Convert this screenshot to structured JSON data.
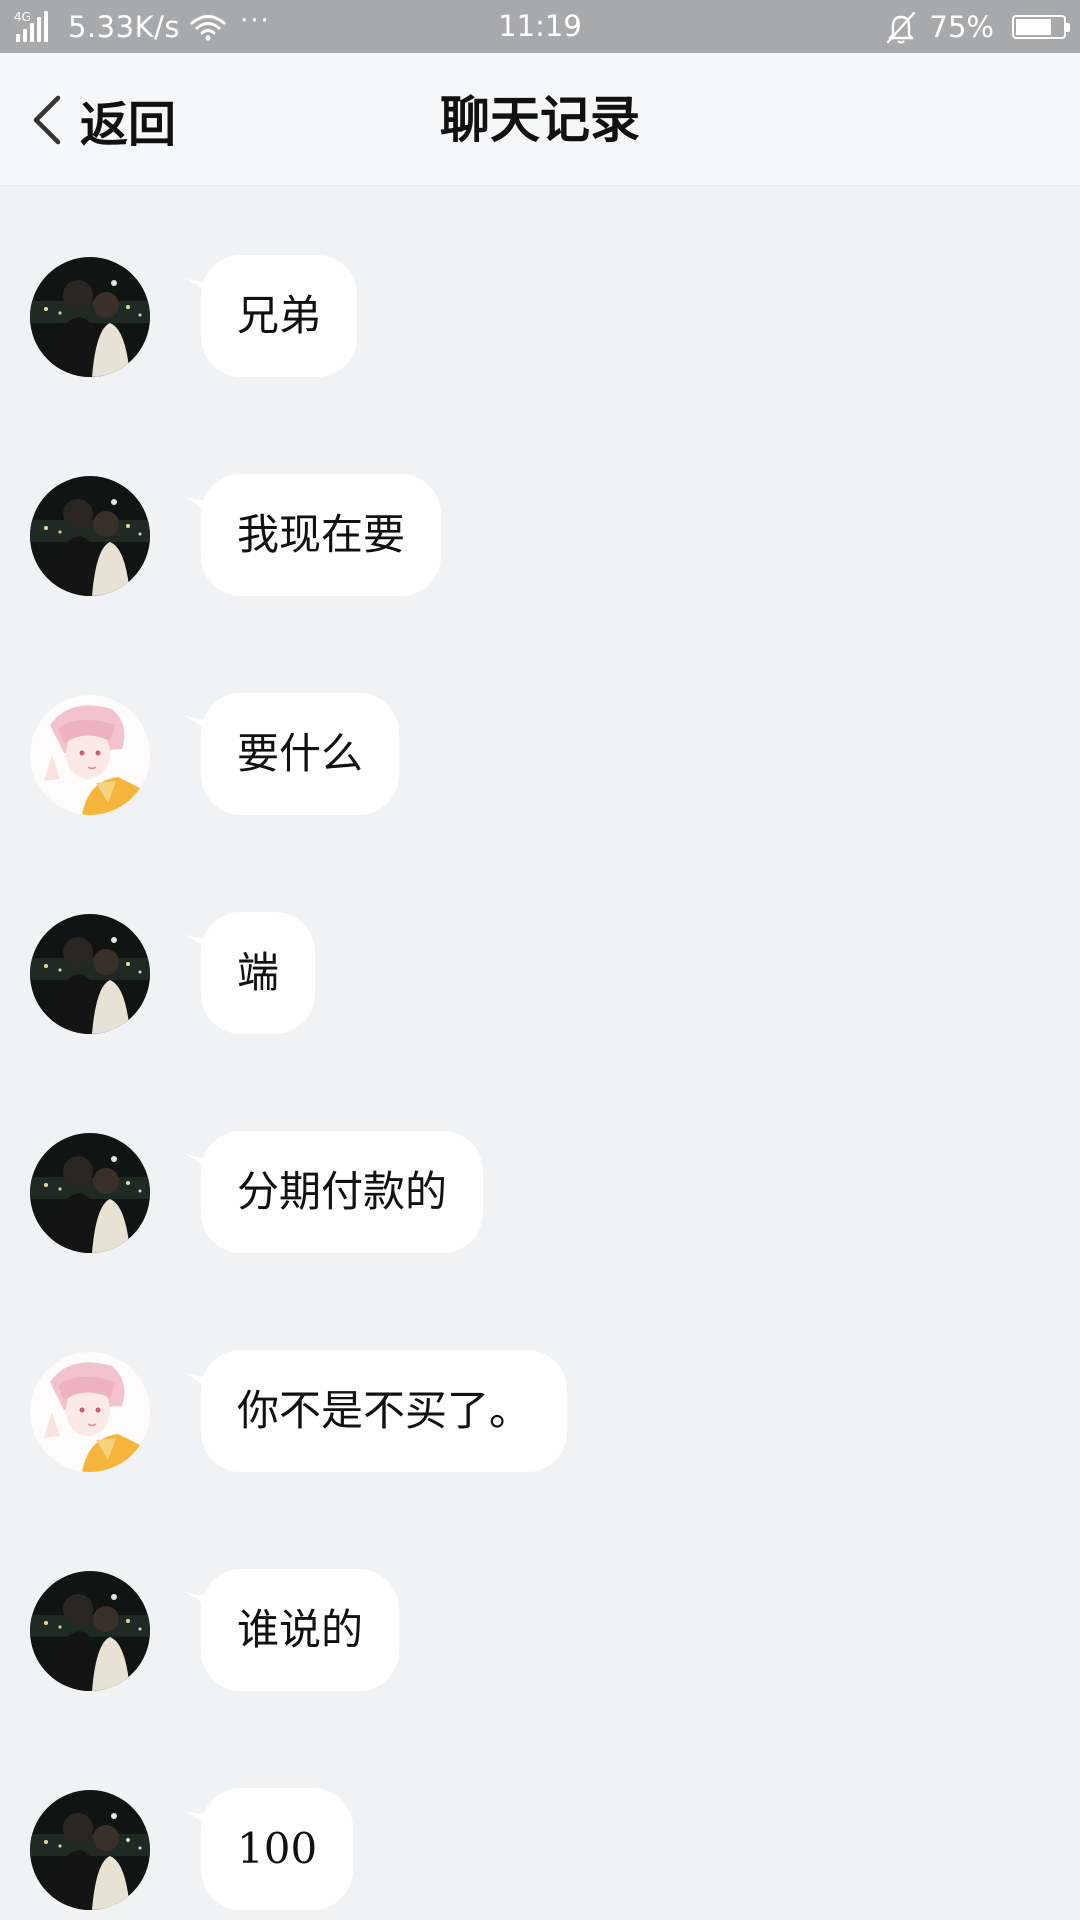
{
  "status_bar": {
    "network": "4G",
    "speed": "5.33K/s",
    "dots": "···",
    "time": "11:19",
    "battery_text": "75%",
    "battery_level": 0.75,
    "icons": [
      "signal-icon",
      "wifi-icon",
      "mute-bell-icon",
      "battery-icon"
    ]
  },
  "header": {
    "back_label": "返回",
    "title": "聊天记录",
    "back_icon": "chevron-left-icon"
  },
  "messages": [
    {
      "sender": "friend-a",
      "text": "兄弟"
    },
    {
      "sender": "friend-a",
      "text": "我现在要"
    },
    {
      "sender": "friend-b",
      "text": "要什么"
    },
    {
      "sender": "friend-a",
      "text": "端"
    },
    {
      "sender": "friend-a",
      "text": "分期付款的"
    },
    {
      "sender": "friend-b",
      "text": "你不是不买了。"
    },
    {
      "sender": "friend-a",
      "text": "谁说的"
    },
    {
      "sender": "friend-a",
      "text": "100"
    }
  ],
  "colors": {
    "status_bar_bg": "#a8a9ab",
    "header_bg": "#f6f7f9",
    "chat_bg": "#f1f2f4",
    "bubble_bg": "#ffffff",
    "text": "#111111"
  }
}
